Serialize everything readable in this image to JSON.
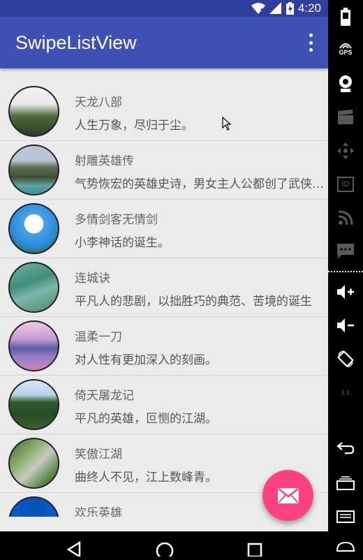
{
  "status_bar": {
    "time": "4:20"
  },
  "app_bar": {
    "title": "SwipeListView"
  },
  "list": [
    {
      "title": "天龙八部",
      "desc": "人生万象，尽归于尘。"
    },
    {
      "title": "射雕英雄传",
      "desc": "气势恢宏的英雄史诗，男女主人公都创了武侠小说的先河"
    },
    {
      "title": "多情剑客无情剑",
      "desc": "小李神话的诞生。"
    },
    {
      "title": "连城诀",
      "desc": "平凡人的悲剧，以拙胜巧的典范、苦境的诞生"
    },
    {
      "title": "温柔一刀",
      "desc": "对人性有更加深入的刻画。"
    },
    {
      "title": "倚天屠龙记",
      "desc": "平凡的英雄，叵恻的江湖。"
    },
    {
      "title": "笑傲江湖",
      "desc": "曲终人不见，江上数峰青。"
    },
    {
      "title": "欢乐英雄",
      "desc": ""
    }
  ],
  "emulator_sidebar": {
    "gps_label": "GPS",
    "id_label": "ID",
    "ratio_label": "1:1"
  },
  "colors": {
    "primary": "#3f51b5",
    "primary_dark": "#303f9f",
    "accent": "#ff4081",
    "background": "#ebebeb"
  }
}
